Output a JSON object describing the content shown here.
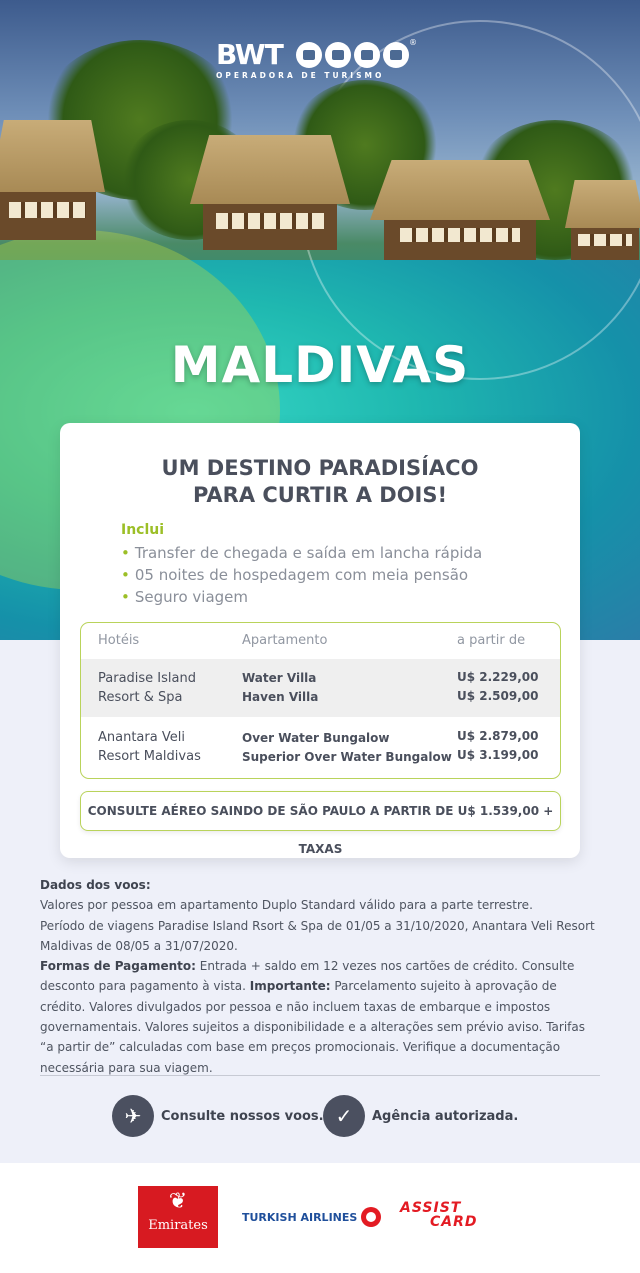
{
  "brand": {
    "name": "BWT",
    "tagline": "OPERADORA DE TURISMO",
    "registered": "®"
  },
  "hero": {
    "title": "MALDIVAS"
  },
  "card": {
    "headline_line1": "UM DESTINO PARADISÍACO",
    "headline_line2": "PARA CURTIR A DOIS!",
    "includes_title": "Inclui",
    "includes": [
      "Transfer de chegada e saída em lancha rápida",
      "05 noites de hospedagem com meia pensão",
      "Seguro viagem"
    ],
    "table": {
      "headers": [
        "Hotéis",
        "Apartamento",
        "a partir de"
      ],
      "rows": [
        {
          "hotel_line1": "Paradise Island",
          "hotel_line2": "Resort & Spa",
          "apt1": "Water Villa",
          "apt2": "Haven Villa",
          "price1": "U$ 2.229,00",
          "price2": "U$ 2.509,00"
        },
        {
          "hotel_line1": "Anantara Veli",
          "hotel_line2": "Resort Maldivas",
          "apt1": "Over Water Bungalow",
          "apt2": "Superior Over Water Bungalow",
          "price1": "U$ 2.879,00",
          "price2": "U$ 3.199,00"
        }
      ]
    },
    "consult_text": "CONSULTE AÉREO SAINDO DE SÃO PAULO A PARTIR DE U$ 1.539,00 + TAXAS"
  },
  "details": {
    "flights_title": "Dados dos voos:",
    "line1": "Valores por pessoa em apartamento Duplo Standard válido para a parte terrestre.",
    "line2": "Período de viagens Paradise Island Rsort & Spa de 01/05 a 31/10/2020, Anantara Veli Resort Maldivas de 08/05 a 31/07/2020.",
    "payment_label": "Formas de Pagamento:",
    "payment_text": " Entrada + saldo em 12 vezes nos cartões de crédito. Consulte desconto para pagamento à vista. ",
    "important_label": "Importante:",
    "important_text": " Parcelamento sujeito à aprovação de crédito. Valores divulgados por pessoa e não incluem taxas de embarque e impostos governamentais. Valores sujeitos a disponibilidade e a alterações sem prévio aviso. Tarifas “a partir de” calculadas com base em preços promocionais. Verifique a documentação necessária para sua viagem."
  },
  "ctas": {
    "flights_label": "Consulte nossos voos.",
    "agency_label": "Agência autorizada."
  },
  "partners": {
    "emirates": "Emirates",
    "turkish": "TURKISH AIRLINES",
    "assist_line1": "ASSIST",
    "assist_line2": "CARD"
  },
  "colors": {
    "accent_green": "#9cbf27",
    "border_green": "#b9d35b",
    "text_dark": "#4a4f5c",
    "cta_circle": "#4b5060",
    "emirates_red": "#d71a21",
    "turkish_blue": "#1f4f9b"
  }
}
